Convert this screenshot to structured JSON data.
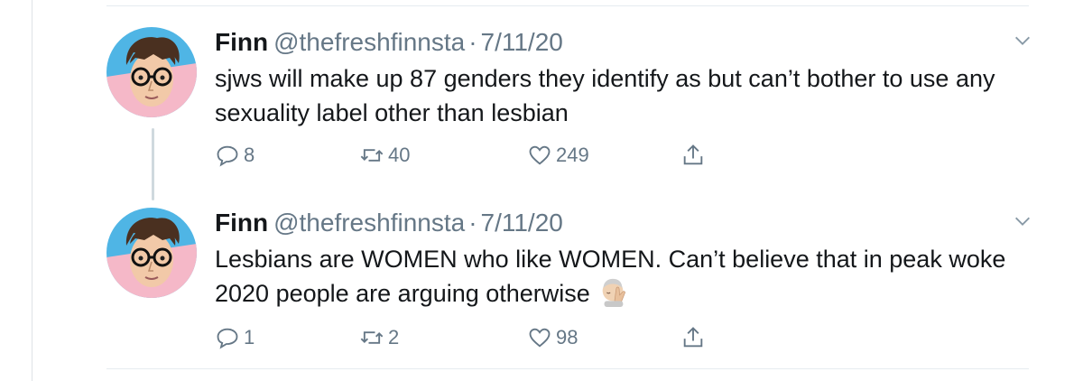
{
  "tweets": [
    {
      "name": "Finn",
      "handle": "@thefreshfinnsta",
      "separator": "·",
      "date": "7/11/20",
      "text": "sjws will make up 87 genders they identify as but can’t bother to use any sexuality label other than lesbian",
      "replies": "8",
      "retweets": "40",
      "likes": "249",
      "emoji": ""
    },
    {
      "name": "Finn",
      "handle": "@thefreshfinnsta",
      "separator": "·",
      "date": "7/11/20",
      "text": "Lesbians are WOMEN who like WOMEN. Can’t believe that in peak woke 2020 people are arguing otherwise",
      "replies": "1",
      "retweets": "2",
      "likes": "98",
      "emoji": "facepalm"
    }
  ],
  "icons": {
    "reply": "reply-icon",
    "retweet": "retweet-icon",
    "like": "heart-icon",
    "share": "share-icon",
    "more": "chevron-down-icon"
  },
  "colors": {
    "text": "#14171a",
    "secondary": "#657786",
    "avatar_blue": "#4fb5e5",
    "avatar_pink": "#f5b8c8"
  }
}
